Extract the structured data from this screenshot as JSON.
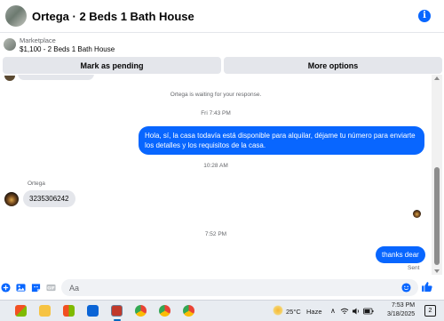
{
  "header": {
    "title": "Ortega · 2 Beds 1 Bath House",
    "info_icon": "i"
  },
  "listing": {
    "source": "Marketplace",
    "title": "$1,100 - 2 Beds 1 Bath House"
  },
  "actions": {
    "mark_pending": "Mark as pending",
    "more_options": "More options"
  },
  "thread": {
    "waiting_text": "Ortega is waiting for your response.",
    "time_1": "Fri 7:43 PM",
    "outgoing_1_line1": "Hola, sí, la casa todavía está disponible para alquilar, déjame tu número para enviarte",
    "outgoing_1_line2": "los detalles y los requisitos de la casa.",
    "time_2": "10:28 AM",
    "sender_name": "Ortega",
    "incoming_1": "3235306242",
    "time_3": "7:52 PM",
    "outgoing_2": "thanks dear",
    "sent_status": "Sent"
  },
  "composer": {
    "placeholder": "Aa"
  },
  "taskbar": {
    "weather_temp": "25°C",
    "weather_desc": "Haze",
    "time": "7:53 PM",
    "date": "3/18/2025",
    "notification_count": "2"
  },
  "colors": {
    "messenger_blue": "#0866ff",
    "button_gray": "#e4e6eb",
    "secondary_text": "#65676b"
  }
}
